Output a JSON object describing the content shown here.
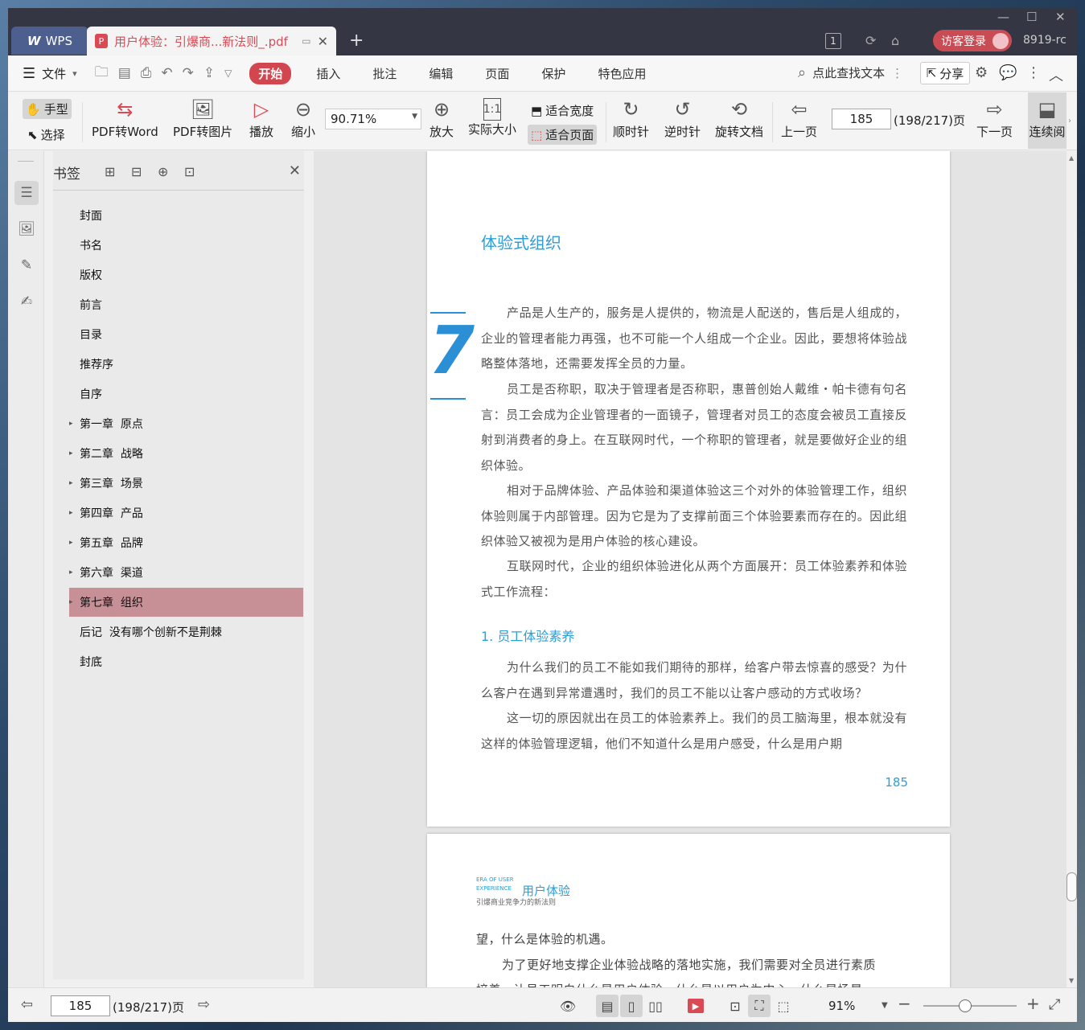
{
  "titlebar": {
    "app_name": "WPS",
    "doc_tab_title": "用户体验：引爆商...新法则_.pdf",
    "login_label": "访客登录",
    "user_id": "8919-rc",
    "badge": "1"
  },
  "menubar": {
    "file_label": "文件",
    "tabs": [
      "开始",
      "插入",
      "批注",
      "编辑",
      "页面",
      "保护",
      "特色应用"
    ],
    "search_label": "点此查找文本",
    "share_label": "分享"
  },
  "toolbar": {
    "hand_label": "手型",
    "select_label": "选择",
    "pdf_word_label": "PDF转Word",
    "pdf_img_label": "PDF转图片",
    "play_label": "播放",
    "zoom_out_label": "缩小",
    "zoom_value": "90.71%",
    "zoom_in_label": "放大",
    "actual_size_label": "实际大小",
    "fit_width_label": "适合宽度",
    "fit_page_label": "适合页面",
    "cw_label": "顺时针",
    "ccw_label": "逆时针",
    "rotate_doc_label": "旋转文档",
    "prev_label": "上一页",
    "page_value": "185",
    "page_total": "(198/217)页",
    "next_label": "下一页",
    "continuous_label": "连续阅"
  },
  "bookmarks": {
    "title": "书签",
    "items": [
      {
        "label": "封面",
        "expandable": false,
        "selected": false
      },
      {
        "label": "书名",
        "expandable": false,
        "selected": false
      },
      {
        "label": "版权",
        "expandable": false,
        "selected": false
      },
      {
        "label": "前言",
        "expandable": false,
        "selected": false
      },
      {
        "label": "目录",
        "expandable": false,
        "selected": false
      },
      {
        "label": "推荐序",
        "expandable": false,
        "selected": false
      },
      {
        "label": "自序",
        "expandable": false,
        "selected": false
      },
      {
        "label": "第一章  原点",
        "expandable": true,
        "selected": false
      },
      {
        "label": "第二章  战略",
        "expandable": true,
        "selected": false
      },
      {
        "label": "第三章  场景",
        "expandable": true,
        "selected": false
      },
      {
        "label": "第四章  产品",
        "expandable": true,
        "selected": false
      },
      {
        "label": "第五章  品牌",
        "expandable": true,
        "selected": false
      },
      {
        "label": "第六章  渠道",
        "expandable": true,
        "selected": false
      },
      {
        "label": "第七章  组织",
        "expandable": true,
        "selected": true
      },
      {
        "label": "后记  没有哪个创新不是荆棘",
        "expandable": false,
        "selected": false
      },
      {
        "label": "封底",
        "expandable": false,
        "selected": false
      }
    ]
  },
  "page1": {
    "chapter_title": "体验式组织",
    "chapter_number": "7",
    "para1": "产品是人生产的，服务是人提供的，物流是人配送的，售后是人组成的，企业的管理者能力再强，也不可能一个人组成一个企业。因此，要想将体验战略整体落地，还需要发挥全员的力量。",
    "para2": "员工是否称职，取决于管理者是否称职，惠普创始人戴维・帕卡德有句名言：员工会成为企业管理者的一面镜子，管理者对员工的态度会被员工直接反射到消费者的身上。在互联网时代，一个称职的管理者，就是要做好企业的组织体验。",
    "para3": "相对于品牌体验、产品体验和渠道体验这三个对外的体验管理工作，组织体验则属于内部管理。因为它是为了支撑前面三个体验要素而存在的。因此组织体验又被视为是用户体验的核心建设。",
    "para4": "互联网时代，企业的组织体验进化从两个方面展开：员工体验素养和体验式工作流程：",
    "section_title": "1. 员工体验素养",
    "para5": "为什么我们的员工不能如我们期待的那样，给客户带去惊喜的感受？为什么客户在遇到异常遭遇时，我们的员工不能以让客户感动的方式收场？",
    "para6": "这一切的原因就出在员工的体验素养上。我们的员工脑海里，根本就没有这样的体验管理逻辑，他们不知道什么是用户感受，什么是用户期",
    "page_number": "185"
  },
  "page2": {
    "header_en_1": "ERA OF USER",
    "header_en_2": "EXPERIENCE",
    "header_title": "用户体验",
    "header_sub": "引爆商业竞争力的新法则",
    "line1": "望，什么是体验的机遇。",
    "line2": "为了更好地支撑企业体验战略的落地实施，我们需要对全员进行素质",
    "line3": "培养，让员工明白什么是用户体验，什么是以用户为中心，什么是场景"
  },
  "statusbar": {
    "page_value": "185",
    "page_total": "(198/217)页",
    "zoom_label": "91%",
    "zoom_fraction": 0.45
  }
}
